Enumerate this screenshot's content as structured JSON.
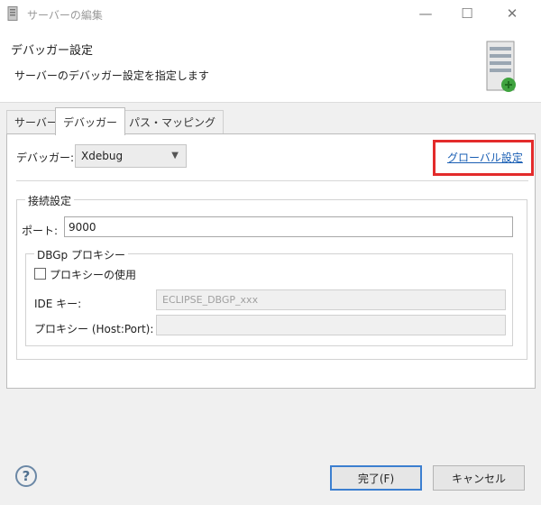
{
  "window": {
    "title": "サーバーの編集",
    "minimize_glyph": "—",
    "maximize_glyph": "☐",
    "close_glyph": "✕"
  },
  "header": {
    "title": "デバッガー設定",
    "description": "サーバーのデバッガー設定を指定します",
    "icon": "server-icon"
  },
  "tabs": [
    {
      "label": "サーバー",
      "active": false
    },
    {
      "label": "デバッガー",
      "active": true
    },
    {
      "label": "パス・マッピング",
      "active": false
    }
  ],
  "debugger": {
    "label": "デバッガー:",
    "selected": "Xdebug",
    "global_link": "グローバル設定"
  },
  "connection": {
    "legend": "接続設定",
    "port_label": "ポート:",
    "port_value": "9000"
  },
  "proxy": {
    "legend": "DBGp プロキシー",
    "use_label": "プロキシーの使用",
    "use_checked": false,
    "ide_label": "IDE キー:",
    "ide_value": "ECLIPSE_DBGP_xxx",
    "host_label": "プロキシー (Host:Port):",
    "host_value": ""
  },
  "buttons": {
    "help": "?",
    "finish": "完了(F)",
    "cancel": "キャンセル"
  },
  "colors": {
    "highlight": "#e32b2b",
    "link": "#1a5fb4",
    "default_button_border": "#3c7fd0"
  }
}
